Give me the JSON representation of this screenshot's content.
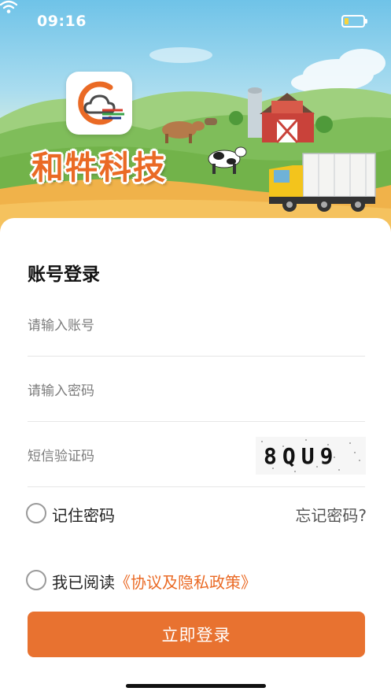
{
  "status_bar": {
    "time": "09:16",
    "icons": [
      "wifi-icon",
      "battery-icon"
    ],
    "battery_color": "#f7d33c"
  },
  "hero": {
    "app_name": "和牪科技",
    "logo_icon": "cloud-logo-icon",
    "scene": "farm-with-barn-cows-truck"
  },
  "login": {
    "title": "账号登录",
    "account_placeholder": "请输入账号",
    "password_placeholder": "请输入密码",
    "sms_placeholder": "短信验证码",
    "captcha_text": "8QU9",
    "remember_label": "记住密码",
    "forgot_label": "忘记密码?",
    "agree_prefix": "我已阅读",
    "policy_link": "《协议及隐私政策》",
    "submit_label": "立即登录"
  },
  "colors": {
    "accent": "#e87230",
    "link": "#ea6a25",
    "text": "#222222",
    "placeholder": "#7d7d7d"
  }
}
